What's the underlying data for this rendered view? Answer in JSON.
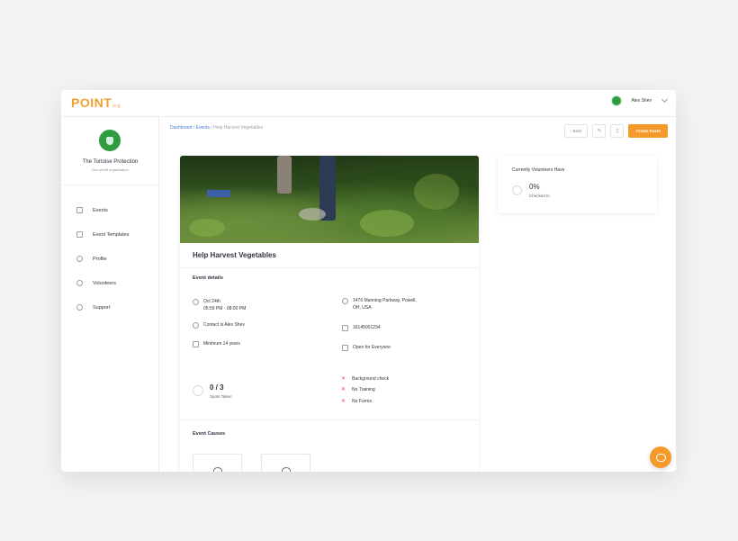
{
  "app": {
    "logo": "POINT",
    "logo_sub": "org"
  },
  "user": {
    "name": "Alex Shev"
  },
  "org": {
    "name": "The Tortoise Protection",
    "type": "Non-profit organization"
  },
  "sidebar": {
    "items": [
      {
        "label": "Events",
        "icon": "calendar-icon"
      },
      {
        "label": "Event Templates",
        "icon": "template-icon"
      },
      {
        "label": "Profile",
        "icon": "person-icon"
      },
      {
        "label": "Volunteers",
        "icon": "people-icon"
      },
      {
        "label": "Support",
        "icon": "lifebuoy-icon"
      }
    ]
  },
  "breadcrumb": {
    "dashboard": "Dashboard",
    "sep": " / ",
    "events": "Events",
    "current": "Help Harvest Vegetables"
  },
  "toolbar": {
    "back": "Back",
    "back_icon": "chevron-left-icon",
    "edit_icon": "pencil-icon",
    "delete_icon": "trash-icon",
    "create": "Create Event"
  },
  "event": {
    "title": "Help Harvest Vegetables",
    "details_title": "Event details",
    "date": "Oct 24th",
    "time": "05:59 PM - 08:00 PM",
    "contact": "Contact is Alex Shev",
    "age": "Minimum 14 years",
    "address_line1": "1476 Manning Parkway, Powell,",
    "address_line2": "OH, USA",
    "phone": "16145001234",
    "access": "Open for Everyone",
    "spots": "0 / 3",
    "spots_label": "Spots Taken",
    "requirements": [
      "Background check",
      "No Training",
      "No Forms"
    ],
    "causes_title": "Event Causes"
  },
  "volunteers": {
    "title": "Currently Volunteers Have",
    "percent": "0%",
    "label": "Checked In"
  },
  "colors": {
    "accent": "#f39a2b",
    "brand_green": "#2e9c3f",
    "link": "#4a7bd4",
    "error": "#e0484f"
  }
}
